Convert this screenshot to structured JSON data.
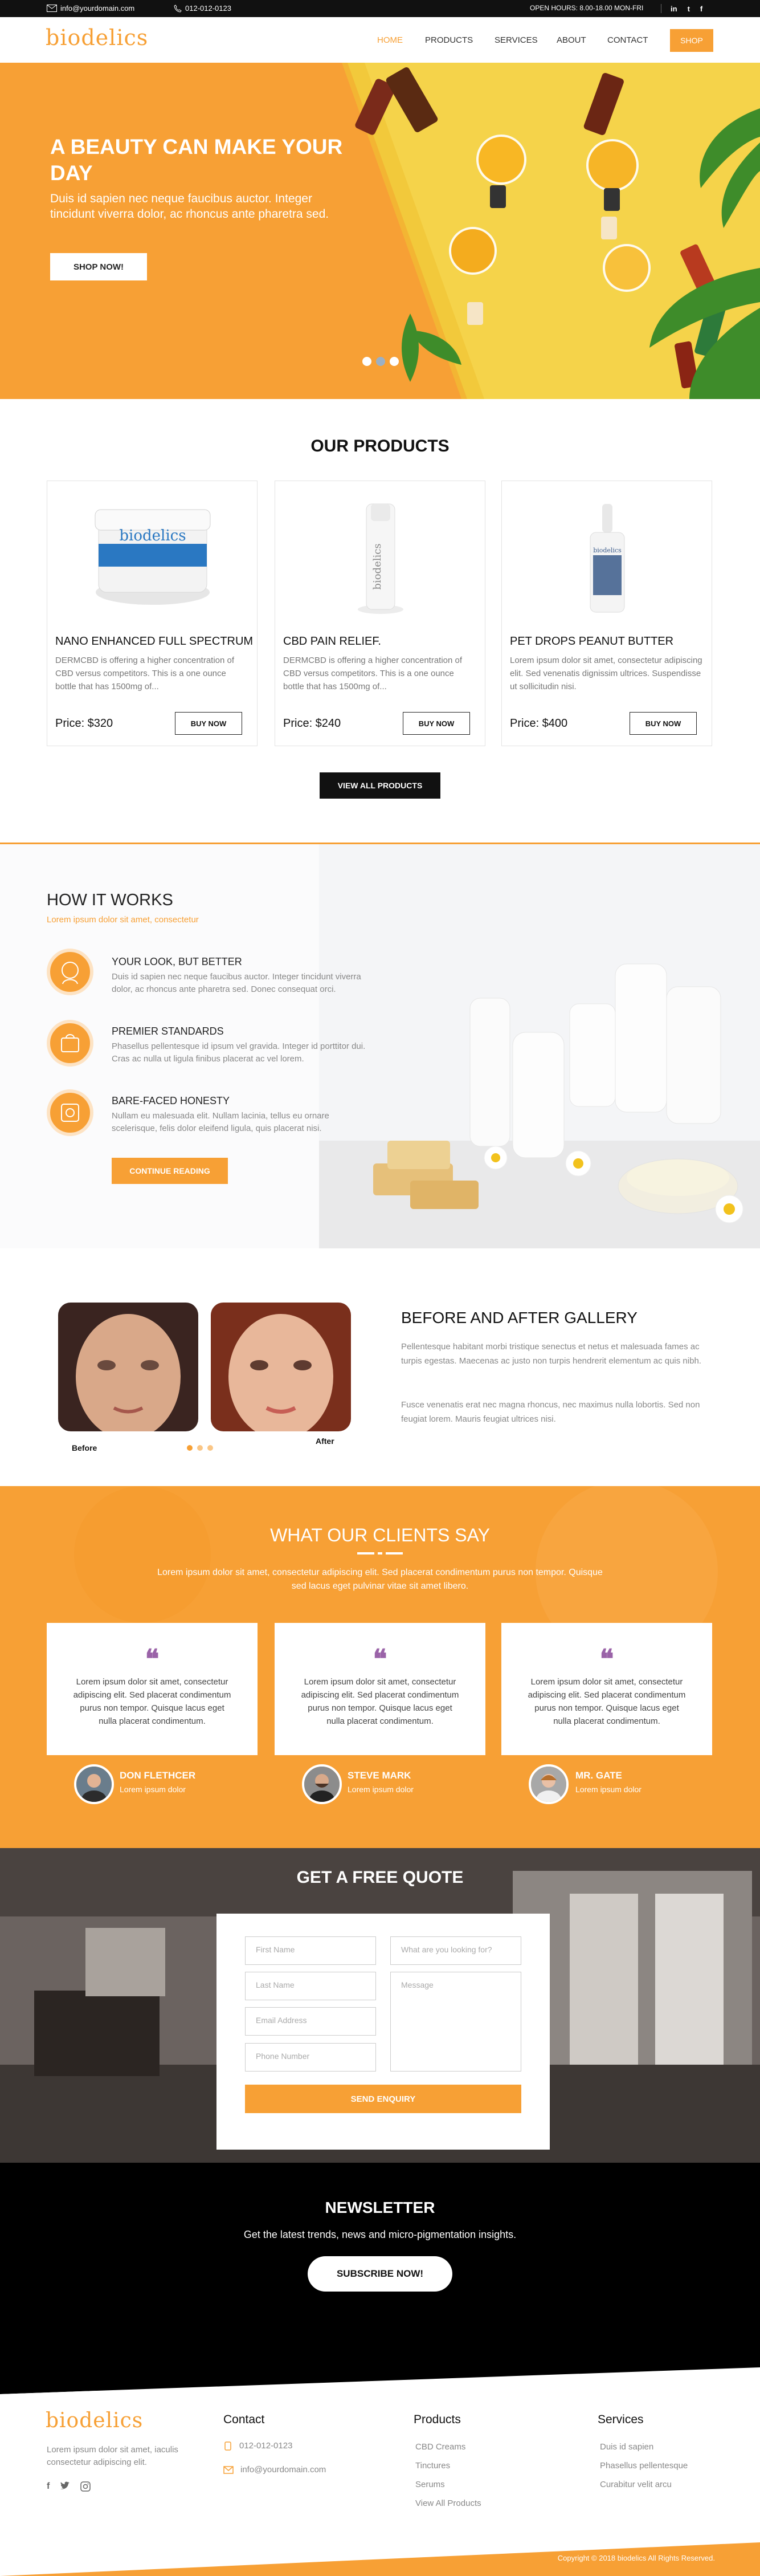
{
  "topbar": {
    "email": "info@yourdomain.com",
    "phone": "012-012-0123",
    "hours": "OPEN HOURS: 8.00-18.00 MON-FRI",
    "social": [
      "in",
      "t",
      "f"
    ]
  },
  "nav": {
    "logo": "biodelics",
    "items": [
      "HOME",
      "PRODUCTS",
      "SERVICES",
      "ABOUT",
      "CONTACT"
    ],
    "shop": "SHOP"
  },
  "hero": {
    "title": "A BEAUTY CAN MAKE YOUR DAY",
    "subtitle": "Duis id sapien nec neque faucibus auctor. Integer tincidunt viverra dolor, ac rhoncus ante pharetra sed.",
    "button": "SHOP NOW!",
    "slider_count": 3,
    "active_slide": 2
  },
  "products": {
    "title": "OUR PRODUCTS",
    "items": [
      {
        "name": "NANO ENHANCED FULL SPECTRUM",
        "desc": "DERMCBD is offering a higher concentration of CBD versus competitors. This is a one ounce bottle that has 1500mg of...",
        "price": "Price: $320",
        "button": "BUY NOW",
        "img_label": "biodelics"
      },
      {
        "name": "CBD PAIN RELIEF.",
        "desc": "DERMCBD is offering a higher concentration of CBD versus competitors. This is a one ounce bottle that has 1500mg of...",
        "price": "Price: $240",
        "button": "BUY NOW",
        "img_label": "biodelics"
      },
      {
        "name": "PET DROPS PEANUT BUTTER",
        "desc": "Lorem ipsum dolor sit amet, consectetur adipiscing elit. Sed venenatis dignissim ultrices. Suspendisse ut sollicitudin nisi.",
        "price": "Price: $400",
        "button": "BUY NOW",
        "img_label": "biodelics"
      }
    ],
    "view_all": "VIEW ALL PRODUCTS"
  },
  "how": {
    "title": "HOW IT WORKS",
    "subtitle": "Lorem ipsum dolor sit amet, consectetur",
    "steps": [
      {
        "title": "YOUR LOOK, BUT BETTER",
        "desc": "Duis id sapien nec neque faucibus auctor. Integer tincidunt viverra dolor, ac rhoncus ante pharetra sed. Donec consequat orci."
      },
      {
        "title": "PREMIER STANDARDS",
        "desc": "Phasellus pellentesque id ipsum vel gravida. Integer id porttitor dui. Cras ac nulla ut ligula finibus placerat ac vel lorem."
      },
      {
        "title": "BARE-FACED HONESTY",
        "desc": "Nullam eu malesuada elit. Nullam lacinia, tellus eu ornare scelerisque, felis dolor eleifend ligula, quis placerat nisi."
      }
    ],
    "button": "CONTINUE READING"
  },
  "gallery": {
    "title": "BEFORE AND AFTER GALLERY",
    "para1": "Pellentesque habitant morbi tristique senectus et netus et malesuada fames ac turpis egestas. Maecenas ac justo non turpis hendrerit elementum ac quis nibh.",
    "para2": "Fusce venenatis erat nec magna rhoncus, nec maximus nulla lobortis. Sed non feugiat lorem. Mauris feugiat ultrices nisi.",
    "before": "Before",
    "after": "After",
    "dots": 3
  },
  "testimonials": {
    "title": "WHAT OUR CLIENTS SAY",
    "subtitle": "Lorem ipsum dolor sit amet, consectetur adipiscing elit. Sed placerat condimentum purus non tempor. Quisque sed lacus eget pulvinar vitae sit amet libero.",
    "items": [
      {
        "text": "Lorem ipsum dolor sit amet, consectetur adipiscing elit. Sed placerat condimentum purus non tempor. Quisque lacus eget nulla placerat condimentum.",
        "name": "DON FLETHCER",
        "sub": "Lorem ipsum dolor"
      },
      {
        "text": "Lorem ipsum dolor sit amet, consectetur adipiscing elit. Sed placerat condimentum purus non tempor. Quisque lacus eget nulla placerat condimentum.",
        "name": "STEVE MARK",
        "sub": "Lorem ipsum dolor"
      },
      {
        "text": "Lorem ipsum dolor sit amet, consectetur adipiscing elit. Sed placerat condimentum purus non tempor. Quisque lacus eget nulla placerat condimentum.",
        "name": "MR. GATE",
        "sub": "Lorem ipsum dolor"
      }
    ]
  },
  "quote": {
    "title": "GET A FREE QUOTE",
    "first_name": "First Name",
    "last_name": "Last Name",
    "email": "Email Address",
    "phone": "Phone Number",
    "looking": "What are you looking for?",
    "message": "Message",
    "button": "SEND ENQUIRY"
  },
  "newsletter": {
    "title": "NEWSLETTER",
    "subtitle": "Get the latest trends, news and micro-pigmentation insights.",
    "button": "SUBSCRIBE NOW!"
  },
  "footer": {
    "logo": "biodelics",
    "about": "Lorem ipsum dolor sit amet, iaculis consectetur adipiscing elit.",
    "contact_title": "Contact",
    "phone": "012-012-0123",
    "email": "info@yourdomain.com",
    "products_title": "Products",
    "products": [
      "CBD Creams",
      "Tinctures",
      "Serums",
      "View All Products"
    ],
    "services_title": "Services",
    "services": [
      "Duis id sapien",
      "Phasellus pellentesque",
      "Curabitur velit arcu"
    ],
    "copyright": "Copyright © 2018 biodelics All Rights Reserved."
  },
  "colors": {
    "accent": "#f7a035",
    "dark": "#111111",
    "quote_mark": "#9a63a8"
  }
}
